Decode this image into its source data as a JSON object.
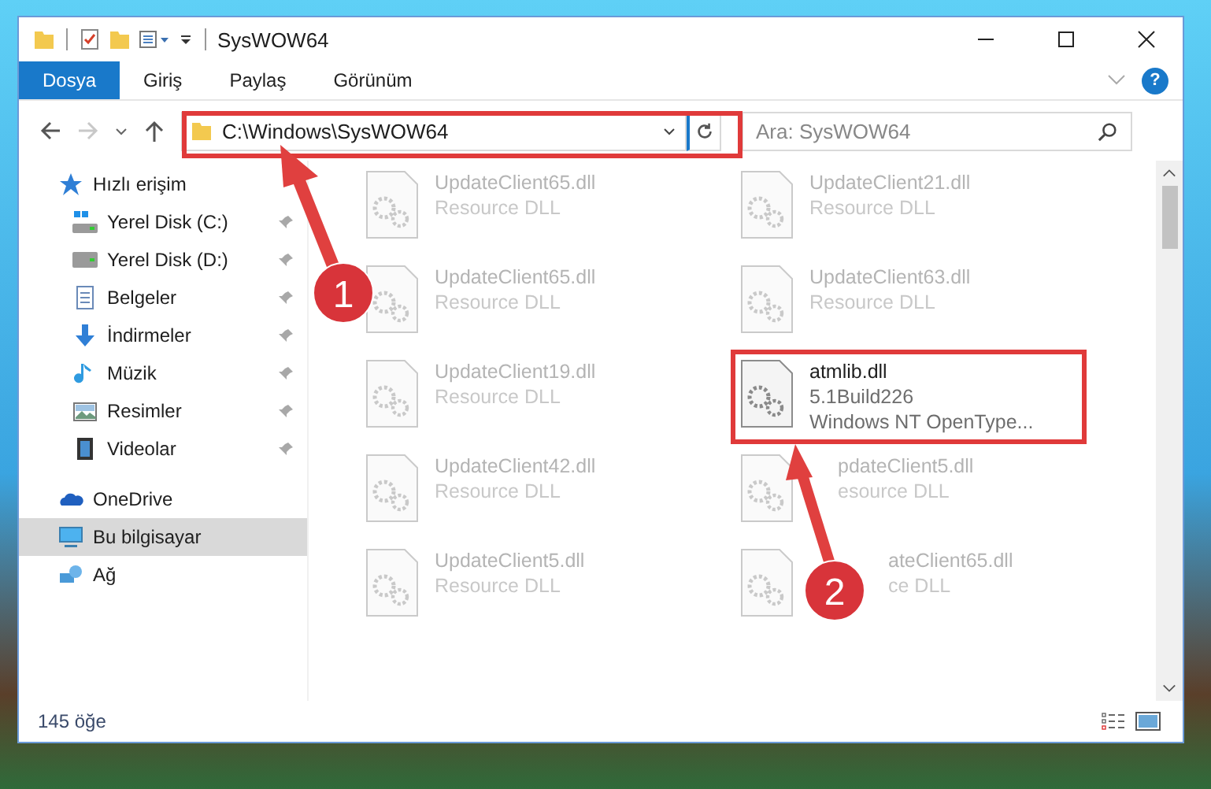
{
  "window": {
    "title": "SysWOW64"
  },
  "ribbon": {
    "tabs": [
      {
        "label": "Dosya",
        "selected": true
      },
      {
        "label": "Giriş",
        "selected": false
      },
      {
        "label": "Paylaş",
        "selected": false
      },
      {
        "label": "Görünüm",
        "selected": false
      }
    ],
    "help": "?"
  },
  "navigation": {
    "forward_disabled": true
  },
  "address_bar": {
    "path": "C:\\Windows\\SysWOW64"
  },
  "search": {
    "placeholder": "Ara: SysWOW64"
  },
  "sidebar": {
    "items": [
      {
        "label": "Hızlı erişim",
        "kind": "quick",
        "pinned": false,
        "selected": false,
        "children": [
          {
            "label": "Yerel Disk (C:)",
            "kind": "disk-c",
            "pinned": true,
            "selected": false
          },
          {
            "label": "Yerel Disk (D:)",
            "kind": "disk",
            "pinned": true,
            "selected": false
          },
          {
            "label": "Belgeler",
            "kind": "documents",
            "pinned": true,
            "selected": false
          },
          {
            "label": "İndirmeler",
            "kind": "downloads",
            "pinned": true,
            "selected": false
          },
          {
            "label": "Müzik",
            "kind": "music",
            "pinned": true,
            "selected": false
          },
          {
            "label": "Resimler",
            "kind": "pictures",
            "pinned": true,
            "selected": false
          },
          {
            "label": "Videolar",
            "kind": "videos",
            "pinned": true,
            "selected": false
          }
        ]
      },
      {
        "label": "OneDrive",
        "kind": "cloud",
        "pinned": false,
        "selected": false
      },
      {
        "label": "Bu bilgisayar",
        "kind": "computer",
        "pinned": false,
        "selected": true
      },
      {
        "label": "Ağ",
        "kind": "network",
        "pinned": false,
        "selected": false
      }
    ]
  },
  "files": [
    {
      "name": "UpdateClient65.dll",
      "details": [
        "Resource DLL"
      ],
      "blurred": true,
      "highlighted": false
    },
    {
      "name": "UpdateClient21.dll",
      "details": [
        "Resource DLL"
      ],
      "blurred": true,
      "highlighted": false
    },
    {
      "name": "UpdateClient65.dll",
      "details": [
        "Resource DLL"
      ],
      "blurred": true,
      "highlighted": false
    },
    {
      "name": "UpdateClient63.dll",
      "details": [
        "Resource DLL"
      ],
      "blurred": true,
      "highlighted": false
    },
    {
      "name": "UpdateClient19.dll",
      "details": [
        "Resource DLL"
      ],
      "blurred": true,
      "highlighted": false
    },
    {
      "name": "atmlib.dll",
      "details": [
        "5.1Build226",
        "Windows NT OpenType..."
      ],
      "blurred": false,
      "highlighted": true
    },
    {
      "name": "UpdateClient42.dll",
      "details": [
        "Resource DLL"
      ],
      "blurred": true,
      "highlighted": false
    },
    {
      "name": "pdateClient5.dll",
      "details": [
        "esource DLL"
      ],
      "blurred": true,
      "highlighted": false,
      "kind": "under-arrow"
    },
    {
      "name": "UpdateClient5.dll",
      "details": [
        "Resource DLL"
      ],
      "blurred": true,
      "highlighted": false
    },
    {
      "name": "ateClient65.dll",
      "details": [
        "ce DLL"
      ],
      "blurred": true,
      "highlighted": false,
      "kind": "under-badge"
    }
  ],
  "status_bar": {
    "item_count": "145 öğe"
  },
  "annotations": [
    {
      "label": "1"
    },
    {
      "label": "2"
    }
  ]
}
